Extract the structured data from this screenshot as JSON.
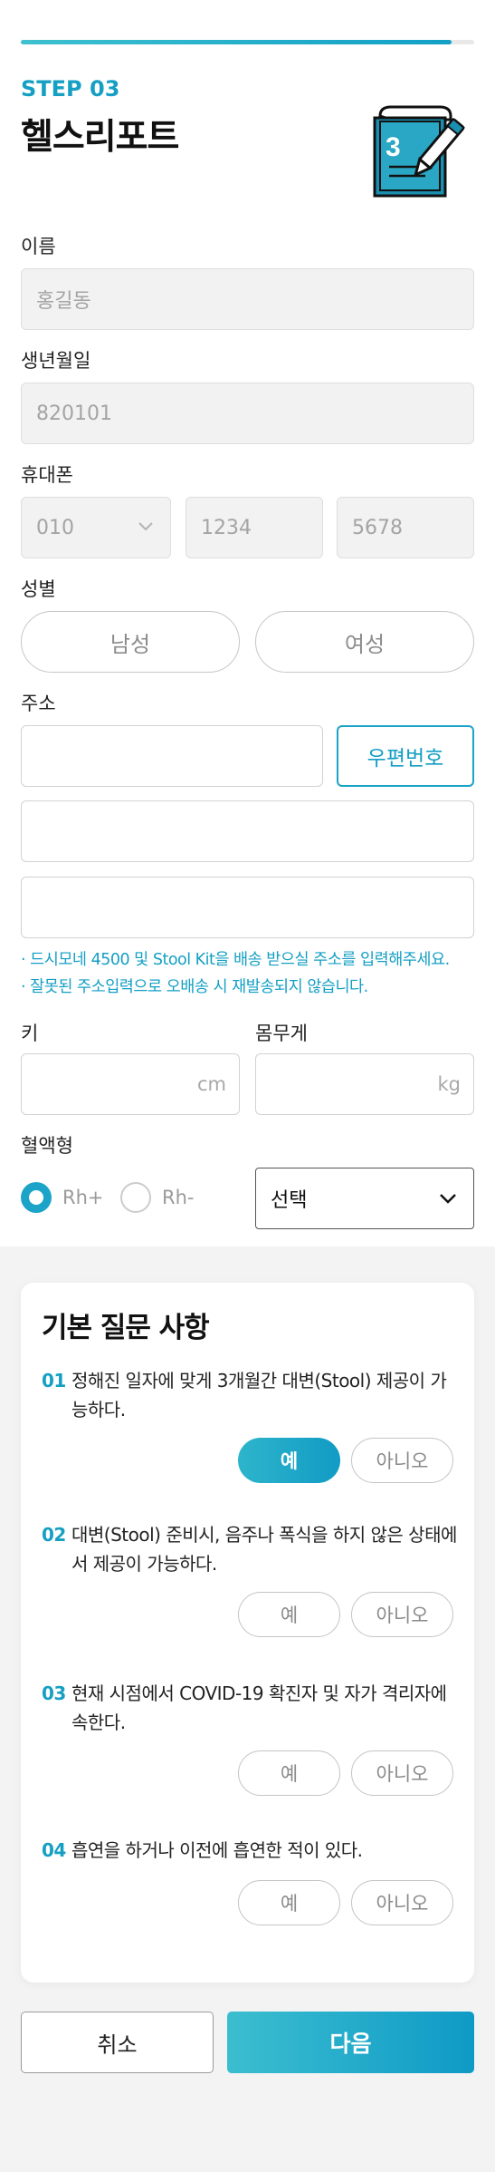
{
  "progress": {
    "fraction": 0.95
  },
  "header": {
    "step": "STEP 03",
    "title": "헬스리포트",
    "badge_number": "3"
  },
  "form": {
    "name": {
      "label": "이름",
      "placeholder": "홍길동"
    },
    "birth": {
      "label": "생년월일",
      "placeholder": "820101"
    },
    "phone": {
      "label": "휴대폰",
      "prefix": "010",
      "middle": "1234",
      "last": "5678"
    },
    "gender": {
      "label": "성별",
      "male": "남성",
      "female": "여성"
    },
    "address": {
      "label": "주소",
      "zip_button": "우편번호",
      "notices": [
        "· 드시모네 4500 및 Stool Kit을 배송 받으실 주소를 입력해주세요.",
        "· 잘못된 주소입력으로 오배송 시 재발송되지 않습니다."
      ]
    },
    "height": {
      "label": "키",
      "unit": "cm"
    },
    "weight": {
      "label": "몸무게",
      "unit": "kg"
    },
    "blood": {
      "label": "혈액형",
      "rh_plus": "Rh+",
      "rh_minus": "Rh-",
      "rh_selected": "Rh+",
      "select_value": "선택"
    }
  },
  "questions": {
    "title": "기본 질문 사항",
    "yes": "예",
    "no": "아니오",
    "items": [
      {
        "num": "01",
        "text": "정해진 일자에 맞게 3개월간 대변(Stool) 제공이 가능하다.",
        "answer": "예"
      },
      {
        "num": "02",
        "text": "대변(Stool) 준비시, 음주나 폭식을 하지 않은 상태에서 제공이 가능하다.",
        "answer": ""
      },
      {
        "num": "03",
        "text": "현재 시점에서 COVID-19 확진자 및 자가 격리자에 속한다.",
        "answer": ""
      },
      {
        "num": "04",
        "text": "흡연을 하거나 이전에 흡연한 적이 있다.",
        "answer": ""
      }
    ]
  },
  "footer": {
    "cancel": "취소",
    "next": "다음"
  },
  "colors": {
    "accent": "#159fc3",
    "accent_gradient_start": "#3bbecf",
    "accent_gradient_end": "#0f9ac6"
  }
}
